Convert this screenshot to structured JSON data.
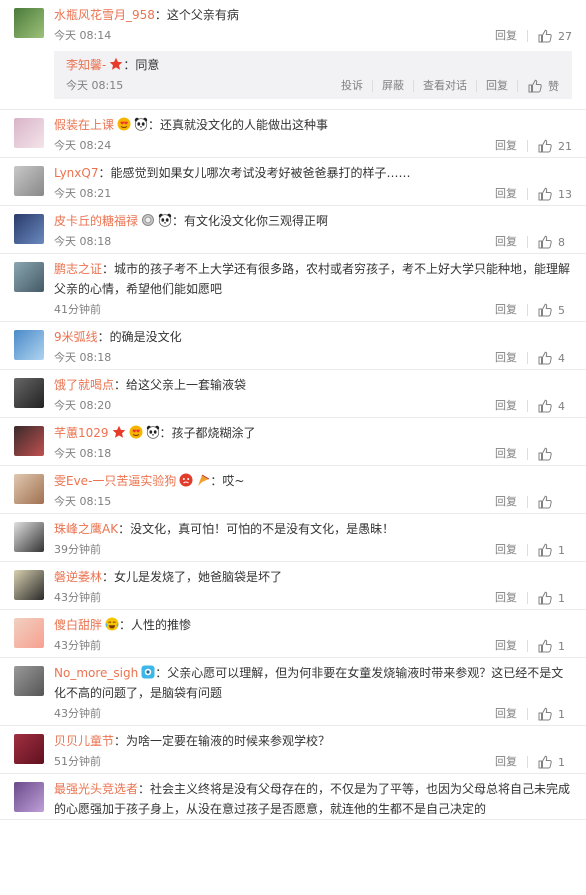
{
  "comments": [
    {
      "user": "水瓶风花雪月_958",
      "text": "：这个父亲有病",
      "time": "今天 08:14",
      "reply": "回复",
      "likes": "27",
      "badges": [],
      "sub": {
        "user": "李知馨-",
        "text": "：同意",
        "time": "今天 08:15",
        "actions": [
          "投诉",
          "屏蔽",
          "查看对话",
          "回复"
        ],
        "like": "赞"
      }
    },
    {
      "user": "假装在上课",
      "text": "：还真就没文化的人能做出这种事",
      "time": "今天 08:24",
      "reply": "回复",
      "likes": "21",
      "badges": [
        "heart-eyes-icon",
        "panda-icon"
      ]
    },
    {
      "user": "LynxQ7",
      "text": "：能感觉到如果女儿哪次考试没考好被爸爸暴打的样子……",
      "time": "今天 08:21",
      "reply": "回复",
      "likes": "13",
      "badges": []
    },
    {
      "user": "皮卡丘的糖福禄",
      "text": "：有文化没文化你三观得正啊",
      "time": "今天 08:18",
      "reply": "回复",
      "likes": "8",
      "badges": [
        "medal-icon",
        "panda-icon"
      ]
    },
    {
      "user": "鹏志之证",
      "text": "：城市的孩子考不上大学还有很多路，农村或者穷孩子，考不上好大学只能种地，能理解父亲的心情，希望他们能如愿吧",
      "time": "41分钟前",
      "reply": "回复",
      "likes": "5",
      "badges": []
    },
    {
      "user": "9米弧线",
      "text": "：的确是没文化",
      "time": "今天 08:18",
      "reply": "回复",
      "likes": "4",
      "badges": []
    },
    {
      "user": "饿了就喝点",
      "text": "：给这父亲上一套输液袋",
      "time": "今天 08:20",
      "reply": "回复",
      "likes": "4",
      "badges": []
    },
    {
      "user": "芊蕙1029",
      "text": "：孩子都烧糊涂了",
      "time": "今天 08:18",
      "reply": "回复",
      "likes": "",
      "badges": [
        "star-icon",
        "heart-eyes-icon",
        "panda-icon"
      ]
    },
    {
      "user": "雯Eve-一只苦逼实验狗",
      "text": "：哎~",
      "time": "今天 08:15",
      "reply": "回复",
      "likes": "",
      "badges": [
        "angry-icon",
        "flag-icon"
      ]
    },
    {
      "user": "珠峰之鹰AK",
      "text": "：没文化，真可怕！可怕的不是没有文化，是愚昧！",
      "time": "39分钟前",
      "reply": "回复",
      "likes": "1",
      "badges": []
    },
    {
      "user": "磐逆萎林",
      "text": "：女儿是发烧了，她爸脑袋是坏了",
      "time": "43分钟前",
      "reply": "回复",
      "likes": "1",
      "badges": []
    },
    {
      "user": "傻白甜胖",
      "text": "：人性的推惨",
      "time": "43分钟前",
      "reply": "回复",
      "likes": "1",
      "badges": [
        "cry-laugh-icon"
      ]
    },
    {
      "user": "No_more_sigh",
      "text": "：父亲心愿可以理解，但为何非要在女童发烧输液时带来参观？这已经不是文化不高的问题了，是脑袋有问题",
      "time": "43分钟前",
      "reply": "回复",
      "likes": "1",
      "badges": [
        "eye-badge-icon"
      ]
    },
    {
      "user": "贝贝儿童节",
      "text": "：为啥一定要在输液的时候来参观学校？",
      "time": "51分钟前",
      "reply": "回复",
      "likes": "1",
      "badges": []
    },
    {
      "user": "最强光头竞选者",
      "text": "：社会主义终将是没有父母存在的，不仅是为了平等，也因为父母总将自己未完成的心愿强加于孩子身上，从没在意过孩子是否愿意，就连他的生都不是自己决定的",
      "time": "",
      "reply": "",
      "likes": "",
      "badges": []
    }
  ],
  "colors": {
    "username": "#eb7350",
    "text": "#333333",
    "meta": "#808080",
    "subbg": "#f2f2f5"
  }
}
